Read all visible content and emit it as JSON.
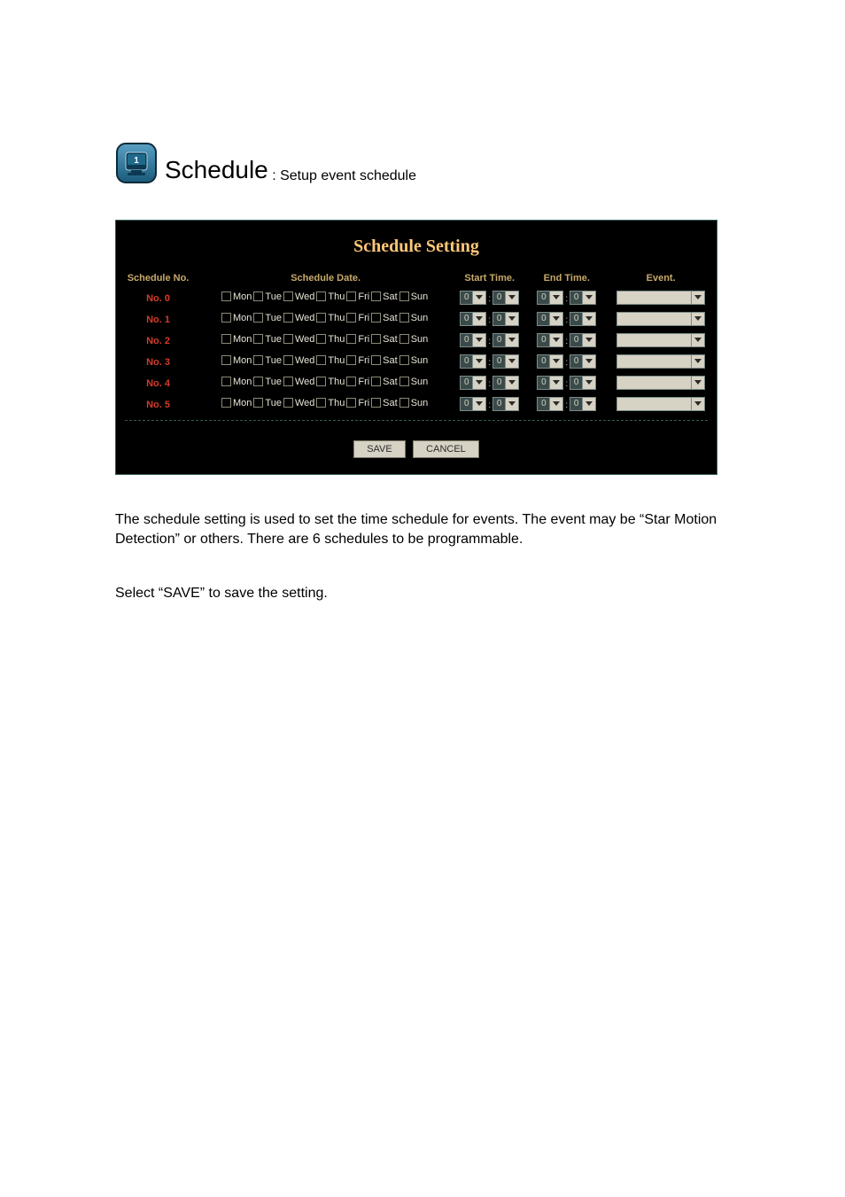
{
  "heading": {
    "title": "Schedule",
    "subtitle": ": Setup event schedule"
  },
  "panel": {
    "title": "Schedule Setting",
    "headers": {
      "no": "Schedule No.",
      "date": "Schedule Date.",
      "start": "Start Time.",
      "end": "End Time.",
      "event": "Event."
    },
    "days": [
      "Mon",
      "Tue",
      "Wed",
      "Thu",
      "Fri",
      "Sat",
      "Sun"
    ],
    "rows": [
      {
        "no": "No. 0",
        "start_h": "0",
        "start_m": "0",
        "end_h": "0",
        "end_m": "0",
        "event": ""
      },
      {
        "no": "No. 1",
        "start_h": "0",
        "start_m": "0",
        "end_h": "0",
        "end_m": "0",
        "event": ""
      },
      {
        "no": "No. 2",
        "start_h": "0",
        "start_m": "0",
        "end_h": "0",
        "end_m": "0",
        "event": ""
      },
      {
        "no": "No. 3",
        "start_h": "0",
        "start_m": "0",
        "end_h": "0",
        "end_m": "0",
        "event": ""
      },
      {
        "no": "No. 4",
        "start_h": "0",
        "start_m": "0",
        "end_h": "0",
        "end_m": "0",
        "event": ""
      },
      {
        "no": "No. 5",
        "start_h": "0",
        "start_m": "0",
        "end_h": "0",
        "end_m": "0",
        "event": ""
      }
    ],
    "buttons": {
      "save": "SAVE",
      "cancel": "CANCEL"
    }
  },
  "text": {
    "p1": "The schedule setting is used to set the time schedule for events. The event may be “Star Motion Detection” or others. There are 6 schedules to be programmable.",
    "p2": "Select “SAVE” to save the setting."
  }
}
